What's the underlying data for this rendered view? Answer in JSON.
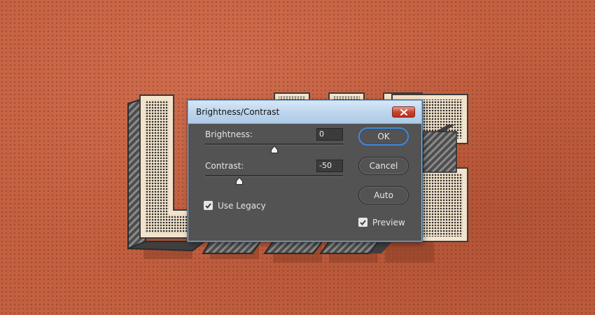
{
  "dialog": {
    "title": "Brightness/Contrast",
    "brightness": {
      "label": "Brightness:",
      "value": "0",
      "slider_fraction": 0.5
    },
    "contrast": {
      "label": "Contrast:",
      "value": "-50",
      "slider_fraction": 0.25
    },
    "use_legacy": {
      "label": "Use Legacy",
      "checked": true
    },
    "preview": {
      "label": "Preview",
      "checked": true
    },
    "buttons": {
      "ok": "OK",
      "cancel": "Cancel",
      "auto": "Auto"
    }
  },
  "colors": {
    "background": "#c26040",
    "dialog_body": "#535353",
    "title_bar": "#c3d9ef",
    "primary_button_border": "#3f88dd",
    "close_button": "#c9442f",
    "artwork_fill": "#f3e3cc",
    "artwork_extrusion": "#4c4c4c"
  }
}
